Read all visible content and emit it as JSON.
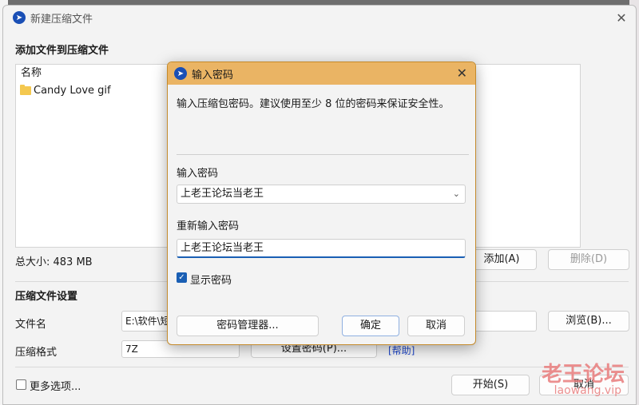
{
  "main_window": {
    "title": "新建压缩文件",
    "close": "✕",
    "add_files_title": "添加文件到压缩文件",
    "list_header": "名称",
    "files": [
      {
        "name": "Candy Love gif"
      }
    ],
    "total_size": "总大小: 483 MB",
    "add_button": "添加(A)",
    "delete_button": "删除(D)",
    "settings_title": "压缩文件设置",
    "filename_label": "文件名",
    "filename_value": "E:\\软件\\短",
    "browse_button": "浏览(B)...",
    "format_label": "压缩格式",
    "format_value": "7Z",
    "set_password_button": "设置密码(P)...",
    "help_link": "[帮助]",
    "more_options_label": "更多选项...",
    "start_button": "开始(S)",
    "cancel_button": "取消"
  },
  "dialog": {
    "title": "输入密码",
    "close": "✕",
    "description": "输入压缩包密码。建议使用至少 8 位的密码来保证安全性。",
    "password_label": "输入密码",
    "password_value": "上老王论坛当老王",
    "repeat_label": "重新输入密码",
    "repeat_value": "上老王论坛当老王",
    "show_password_label": "显示密码",
    "show_password_checked": true,
    "manager_button": "密码管理器...",
    "ok_button": "确定",
    "cancel_button": "取消"
  },
  "watermark": {
    "text": "老王论坛",
    "sub": "laowang.vip"
  },
  "colors": {
    "dialog_titlebar": "#eab464",
    "accent": "#1a5fb4"
  }
}
